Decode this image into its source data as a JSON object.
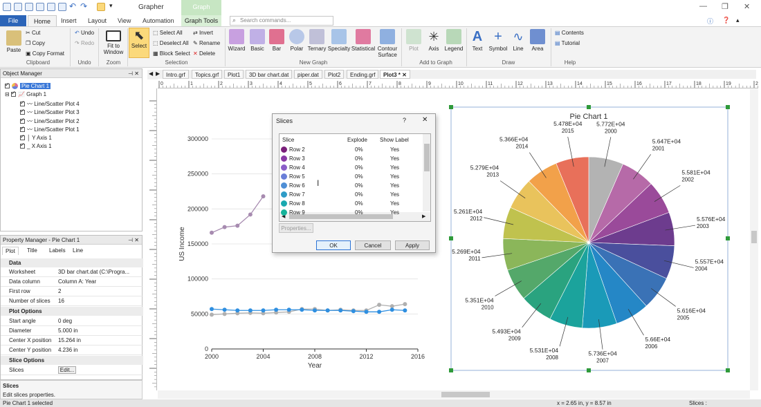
{
  "app": {
    "title": "Grapher",
    "context_tab": "Graph"
  },
  "quick_access_icons": [
    "new-icon",
    "open-icon",
    "save-icon",
    "print-icon",
    "undo-icon",
    "redo-icon",
    "select-icon",
    "dropdown-icon"
  ],
  "tabs": [
    "File",
    "Home",
    "Insert",
    "Layout",
    "View",
    "Automation",
    "Graph Tools"
  ],
  "search_placeholder": "Search commands...",
  "ribbon": {
    "clipboard": {
      "paste": "Paste",
      "cut": "Cut",
      "copy": "Copy",
      "copy_format": "Copy Format",
      "label": "Clipboard"
    },
    "undo": {
      "undo": "Undo",
      "redo": "Redo",
      "label": "Undo"
    },
    "zoom": {
      "fit": "Fit to Window",
      "label": "Zoom"
    },
    "selection": {
      "select": "Select",
      "select_all": "Select All",
      "deselect_all": "Deselect All",
      "block_select": "Block Select",
      "invert": "Invert",
      "rename": "Rename",
      "delete": "Delete",
      "label": "Selection"
    },
    "new_graph": {
      "items": [
        "Wizard",
        "Basic",
        "Bar",
        "Polar",
        "Ternary",
        "Specialty",
        "Statistical",
        "Contour Surface"
      ],
      "label": "New Graph"
    },
    "add_to_graph": {
      "items": [
        "Plot",
        "Axis",
        "Legend"
      ],
      "label": "Add to Graph"
    },
    "draw": {
      "items": [
        "Text",
        "Symbol",
        "Line",
        "Area"
      ],
      "label": "Draw"
    },
    "help": {
      "contents": "Contents",
      "tutorial": "Tutorial",
      "label": "Help"
    }
  },
  "object_manager": {
    "title": "Object Manager",
    "items": [
      "Pie Chart 1",
      "Graph 1",
      "Line/Scatter Plot 4",
      "Line/Scatter Plot 3",
      "Line/Scatter Plot 2",
      "Line/Scatter Plot 1",
      "Y Axis 1",
      "X Axis 1"
    ]
  },
  "property_manager": {
    "title": "Property Manager - Pie Chart 1",
    "tabs": [
      "Plot",
      "Title",
      "Labels",
      "Line"
    ],
    "sections": {
      "data": "Data",
      "plot_options": "Plot Options",
      "slice_options": "Slice Options"
    },
    "rows": {
      "worksheet": [
        "Worksheet",
        "3D bar chart.dat (C:\\Progra..."
      ],
      "data_column": [
        "Data column",
        "Column A: Year"
      ],
      "first_row": [
        "First row",
        "2"
      ],
      "num_slices": [
        "Number of slices",
        "16"
      ],
      "start_angle": [
        "Start angle",
        "0 deg"
      ],
      "diameter": [
        "Diameter",
        "5.000 in"
      ],
      "center_x": [
        "Center X position",
        "15.264 in"
      ],
      "center_y": [
        "Center Y position",
        "4.236 in"
      ],
      "slices": [
        "Slices",
        "Edit..."
      ]
    }
  },
  "help_box": {
    "title": "Slices",
    "text": "Edit slices properties."
  },
  "status": {
    "left": "Pie Chart 1 selected",
    "coords": "x = 2.65 in, y = 8.57 in",
    "right": "Slices :"
  },
  "doc_tabs": [
    "Intro.grf",
    "Topics.grf",
    "Plot1",
    "3D bar chart.dat",
    "piper.dat",
    "Plot2",
    "Ending.grf",
    "Plot3 *"
  ],
  "dialog": {
    "title": "Slices",
    "help": "?",
    "close": "✕",
    "columns": [
      "Slice",
      "Explode",
      "Show Label"
    ],
    "rows": [
      {
        "name": "Row 2",
        "explode": "0%",
        "show": "Yes",
        "color": "#7a1f7a"
      },
      {
        "name": "Row 3",
        "explode": "0%",
        "show": "Yes",
        "color": "#8a3aa6"
      },
      {
        "name": "Row 4",
        "explode": "0%",
        "show": "Yes",
        "color": "#8b5ec8"
      },
      {
        "name": "Row 5",
        "explode": "0%",
        "show": "Yes",
        "color": "#6a7fd8"
      },
      {
        "name": "Row 6",
        "explode": "0%",
        "show": "Yes",
        "color": "#4f8fd6"
      },
      {
        "name": "Row 7",
        "explode": "0%",
        "show": "Yes",
        "color": "#2f9cc7"
      },
      {
        "name": "Row 8",
        "explode": "0%",
        "show": "Yes",
        "color": "#1aa9b0"
      },
      {
        "name": "Row 9",
        "explode": "0%",
        "show": "Yes",
        "color": "#16b39a"
      }
    ],
    "properties": "Properties...",
    "ok": "OK",
    "cancel": "Cancel",
    "apply": "Apply"
  },
  "chart_data": [
    {
      "type": "line",
      "xlabel": "Year",
      "ylabel": "US Income",
      "xlim": [
        2000,
        2016
      ],
      "ylim": [
        0,
        300000
      ],
      "xticks": [
        "2000",
        "2004",
        "2008",
        "2012",
        "2016"
      ],
      "yticks": [
        "0",
        "50000",
        "100000",
        "150000",
        "200000",
        "250000",
        "300000"
      ],
      "series": [
        {
          "color": "#a78bb0",
          "x": [
            2000,
            2001,
            2002,
            2003,
            2004
          ],
          "values": [
            166000,
            174000,
            176000,
            192000,
            218000
          ]
        },
        {
          "color": "#b0b0b0",
          "x": [
            2000,
            2001,
            2002,
            2003,
            2004,
            2005,
            2006,
            2007,
            2008,
            2009,
            2010,
            2011,
            2012,
            2013,
            2014,
            2015
          ],
          "values": [
            49000,
            50000,
            51000,
            51500,
            51000,
            52000,
            53000,
            57000,
            57000,
            55000,
            56000,
            55000,
            55000,
            63000,
            61000,
            64000
          ]
        },
        {
          "color": "#2f8fe0",
          "x": [
            2000,
            2001,
            2002,
            2003,
            2004,
            2005,
            2006,
            2007,
            2008,
            2009,
            2010,
            2011,
            2012,
            2013,
            2014,
            2015
          ],
          "values": [
            57000,
            56000,
            55000,
            55000,
            55000,
            56000,
            56000,
            56000,
            55000,
            55000,
            55000,
            54000,
            53000,
            53000,
            56000,
            55000
          ]
        }
      ]
    },
    {
      "type": "pie",
      "title": "Pie Chart 1",
      "categories": [
        "2000",
        "2001",
        "2002",
        "2003",
        "2004",
        "2005",
        "2006",
        "2007",
        "2008",
        "2009",
        "2010",
        "2011",
        "2012",
        "2013",
        "2014",
        "2015"
      ],
      "labels": [
        "5.772E+04",
        "5.647E+04",
        "5.581E+04",
        "5.576E+04",
        "5.557E+04",
        "5.616E+04",
        "5.66E+04",
        "5.736E+04",
        "5.531E+04",
        "5.493E+04",
        "5.351E+04",
        "5.269E+04",
        "5.261E+04",
        "5.279E+04",
        "5.366E+04",
        "5.478E+04"
      ],
      "values": [
        57720,
        56470,
        55810,
        55760,
        55570,
        56160,
        56600,
        57360,
        55310,
        54930,
        53510,
        52690,
        52610,
        52790,
        53660,
        54780
      ],
      "colors": [
        "#b3b3b3",
        "#b66aa8",
        "#9a4a9a",
        "#6d3c8e",
        "#4a4f9d",
        "#3a72b6",
        "#2587c6",
        "#1a9ab8",
        "#1ba39c",
        "#2aa37f",
        "#54a86a",
        "#8bb65a",
        "#c0c24e",
        "#e9c35c",
        "#f2a14a",
        "#e8705a"
      ]
    }
  ]
}
